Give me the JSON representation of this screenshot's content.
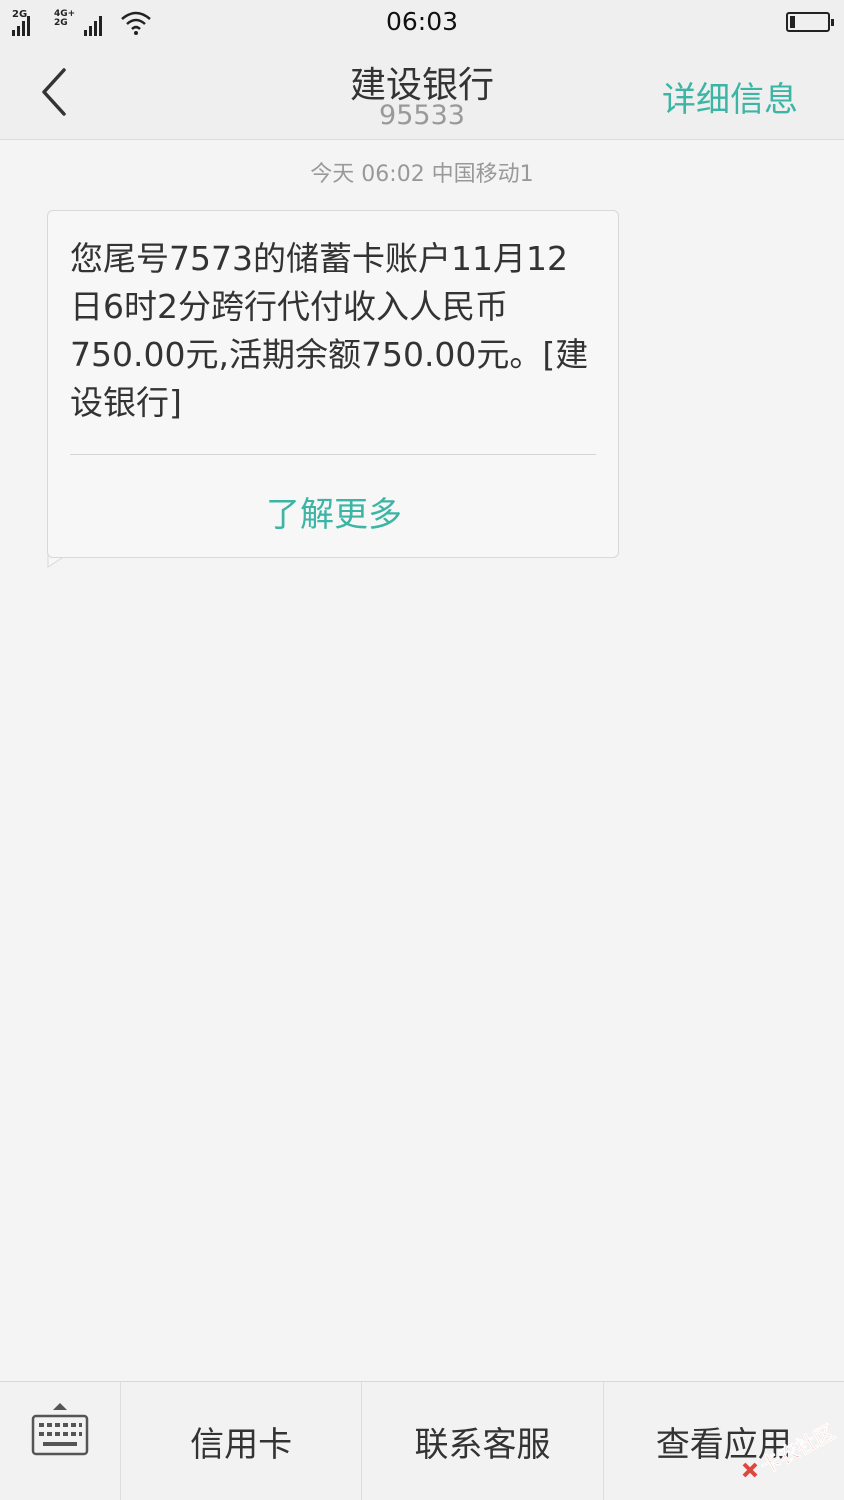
{
  "status_bar": {
    "signal1_tag": "2G",
    "signal2_tag": "4G+ 2G",
    "time": "06:03",
    "battery_level_percent": 15
  },
  "header": {
    "back_icon": "chevron-left-icon",
    "title": "建设银行",
    "number": "95533",
    "details_label": "详细信息"
  },
  "thread": {
    "timestamp": "今天  06:02  中国移动1",
    "message": {
      "text": "您尾号7573的储蓄卡账户11月12日6时2分跨行代付收入人民币750.00元,活期余额750.00元。[建设银行]",
      "more_label": "了解更多"
    }
  },
  "bottom_menu": {
    "keyboard_icon": "keyboard-icon",
    "items": [
      "信用卡",
      "联系客服",
      "查看应用"
    ]
  },
  "watermark": {
    "text": "卡农社区"
  },
  "colors": {
    "accent": "#3cb5a4",
    "background": "#f4f4f4",
    "header": "#efefef",
    "text": "#333333",
    "muted": "#999999"
  }
}
